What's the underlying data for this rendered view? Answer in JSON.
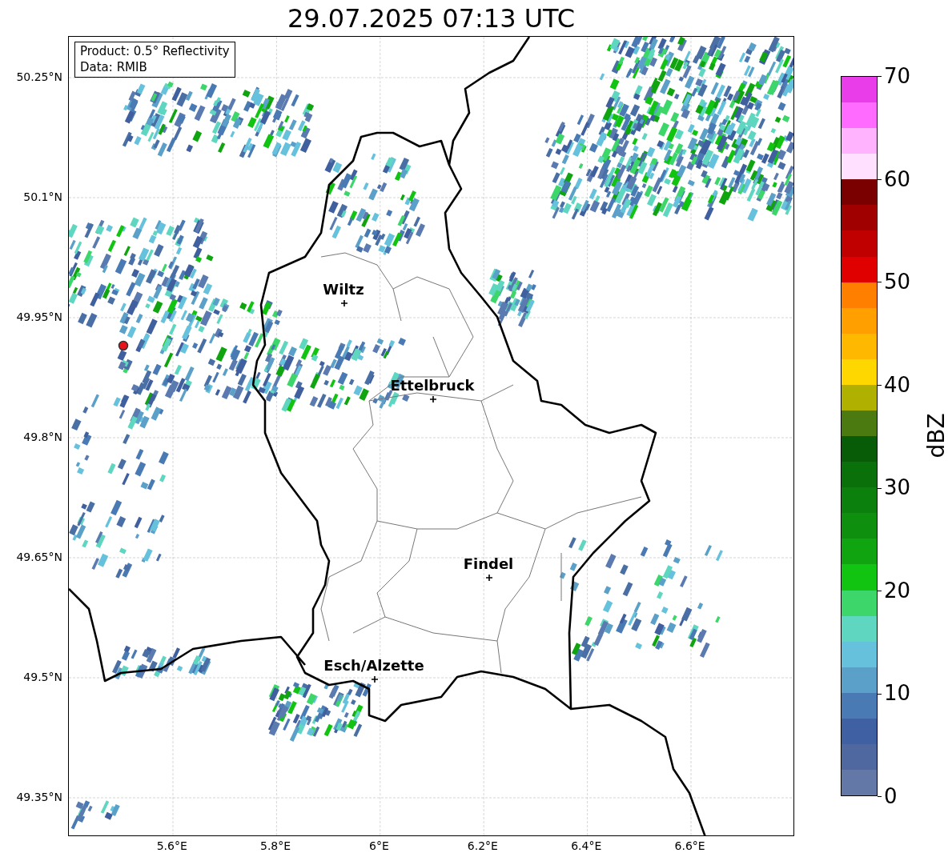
{
  "title": "29.07.2025 07:13 UTC",
  "info_box": [
    "Product: 0.5° Reflectivity",
    "Data: RMIB"
  ],
  "cities": [
    {
      "name": "Wiltz"
    },
    {
      "name": "Ettelbruck"
    },
    {
      "name": "Findel"
    },
    {
      "name": "Esch/Alzette"
    }
  ],
  "y_ticks": [
    "50.25°N",
    "50.1°N",
    "49.95°N",
    "49.8°N",
    "49.65°N",
    "49.5°N",
    "49.35°N"
  ],
  "x_ticks": [
    "5.6°E",
    "5.8°E",
    "6°E",
    "6.2°E",
    "6.4°E",
    "6.6°E"
  ],
  "colorbar": {
    "label": "dBZ",
    "ticks": [
      "70",
      "60",
      "50",
      "40",
      "30",
      "20",
      "10",
      "0"
    ],
    "segments": [
      {
        "color": "#e83de8"
      },
      {
        "color": "#ff6bff"
      },
      {
        "color": "#ffb3ff"
      },
      {
        "color": "#ffe0ff"
      },
      {
        "color": "#7a0000"
      },
      {
        "color": "#a00000"
      },
      {
        "color": "#c00000"
      },
      {
        "color": "#e00000"
      },
      {
        "color": "#ff7f00"
      },
      {
        "color": "#ff9f00"
      },
      {
        "color": "#ffb800"
      },
      {
        "color": "#ffd700"
      },
      {
        "color": "#b0b000"
      },
      {
        "color": "#4a7a10"
      },
      {
        "color": "#085c08"
      },
      {
        "color": "#0a700a"
      },
      {
        "color": "#0c800c"
      },
      {
        "color": "#0e900e"
      },
      {
        "color": "#10a510"
      },
      {
        "color": "#12c412"
      },
      {
        "color": "#3dd66a"
      },
      {
        "color": "#5fd7c0"
      },
      {
        "color": "#66c2dc"
      },
      {
        "color": "#5aa0c8"
      },
      {
        "color": "#4a7ab4"
      },
      {
        "color": "#4060a4"
      },
      {
        "color": "#5068a0"
      },
      {
        "color": "#6478a8"
      }
    ]
  }
}
